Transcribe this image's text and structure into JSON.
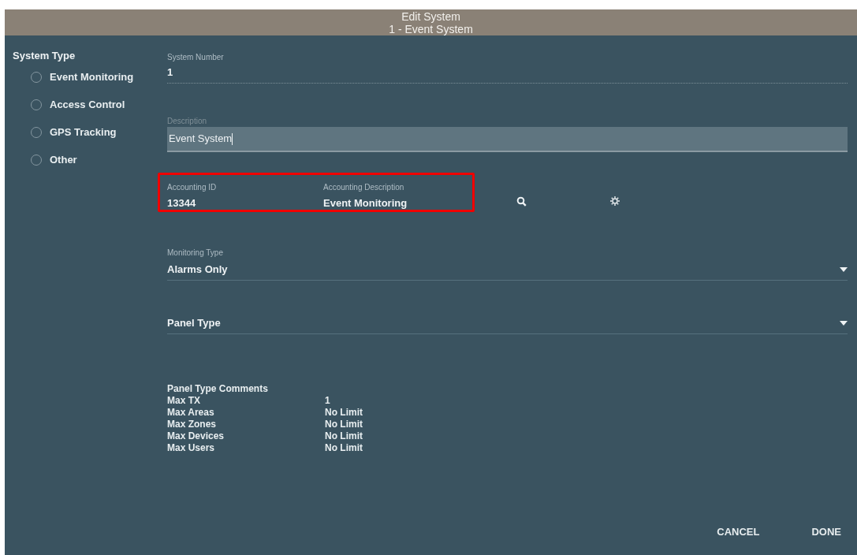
{
  "dialog": {
    "title": "Edit System",
    "subtitle": "1 - Event System"
  },
  "system_type": {
    "heading": "System Type",
    "options": [
      {
        "label": "Event Monitoring",
        "selected": false
      },
      {
        "label": "Access Control",
        "selected": false
      },
      {
        "label": "GPS Tracking",
        "selected": false
      },
      {
        "label": "Other",
        "selected": false
      }
    ]
  },
  "system_number": {
    "label": "System Number",
    "value": "1"
  },
  "description": {
    "label": "Description",
    "value": "Event System"
  },
  "accounting": {
    "highlighted": true,
    "id_label": "Accounting ID",
    "id_value": "13344",
    "description_label": "Accounting Description",
    "description_value": "Event Monitoring"
  },
  "monitoring_type": {
    "label": "Monitoring Type",
    "value": "Alarms Only"
  },
  "panel_type": {
    "placeholder": "Panel Type"
  },
  "panel_type_comments": {
    "heading": "Panel Type Comments",
    "rows": [
      {
        "name": "Max TX",
        "value": "1"
      },
      {
        "name": "Max Areas",
        "value": "No Limit"
      },
      {
        "name": "Max Zones",
        "value": "No Limit"
      },
      {
        "name": "Max Devices",
        "value": "No Limit"
      },
      {
        "name": "Max Users",
        "value": "No Limit"
      }
    ]
  },
  "buttons": [
    "CANCEL",
    "DONE"
  ]
}
